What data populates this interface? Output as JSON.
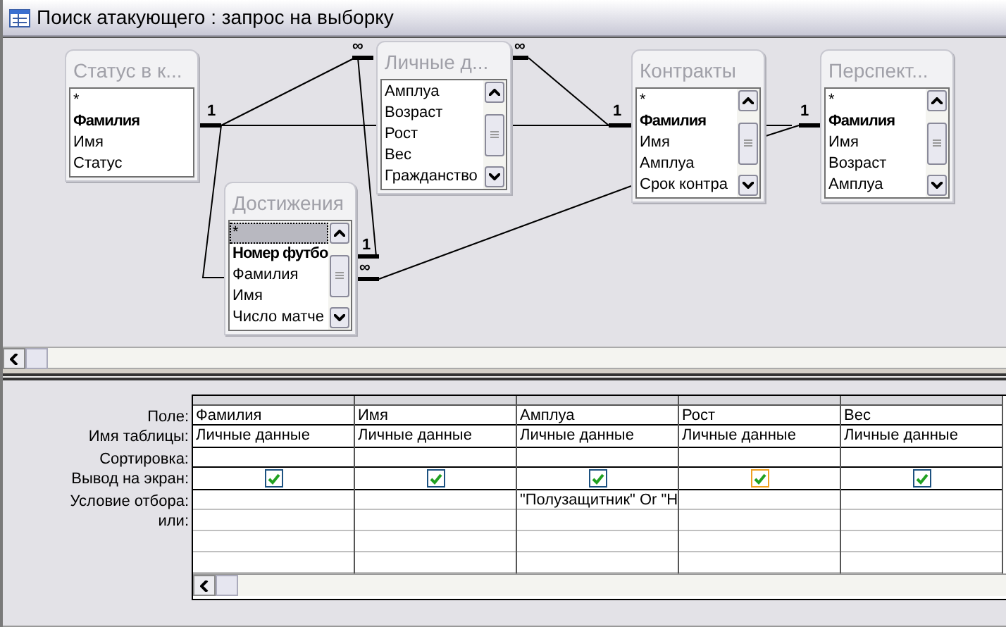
{
  "window": {
    "title": "Поиск атакующего : запрос на выборку"
  },
  "tables": [
    {
      "title": "Статус в к...",
      "scrollbar": false,
      "fields": [
        {
          "name": "*",
          "key": false,
          "selected": false
        },
        {
          "name": "Фамилия",
          "key": true,
          "selected": false
        },
        {
          "name": "Имя",
          "key": false,
          "selected": false
        },
        {
          "name": "Статус",
          "key": false,
          "selected": false
        }
      ]
    },
    {
      "title": "Личные д...",
      "scrollbar": true,
      "fields": [
        {
          "name": "Амплуа",
          "key": false,
          "selected": false
        },
        {
          "name": "Возраст",
          "key": false,
          "selected": false
        },
        {
          "name": "Рост",
          "key": false,
          "selected": false
        },
        {
          "name": "Вес",
          "key": false,
          "selected": false
        },
        {
          "name": "Гражданство",
          "key": false,
          "selected": false
        }
      ]
    },
    {
      "title": "Достижения",
      "scrollbar": true,
      "fields": [
        {
          "name": "*",
          "key": false,
          "selected": true
        },
        {
          "name": "Номер футбо",
          "key": true,
          "selected": false
        },
        {
          "name": "Фамилия",
          "key": false,
          "selected": false
        },
        {
          "name": "Имя",
          "key": false,
          "selected": false
        },
        {
          "name": "Число матче",
          "key": false,
          "selected": false
        }
      ]
    },
    {
      "title": "Контракты",
      "scrollbar": true,
      "fields": [
        {
          "name": "*",
          "key": false,
          "selected": false
        },
        {
          "name": "Фамилия",
          "key": true,
          "selected": false
        },
        {
          "name": "Имя",
          "key": false,
          "selected": false
        },
        {
          "name": "Амплуа",
          "key": false,
          "selected": false
        },
        {
          "name": "Срок контра",
          "key": false,
          "selected": false
        }
      ]
    },
    {
      "title": "Перспект...",
      "scrollbar": true,
      "fields": [
        {
          "name": "*",
          "key": false,
          "selected": false
        },
        {
          "name": "Фамилия",
          "key": true,
          "selected": false
        },
        {
          "name": "Имя",
          "key": false,
          "selected": false
        },
        {
          "name": "Возраст",
          "key": false,
          "selected": false
        },
        {
          "name": "Амплуа",
          "key": false,
          "selected": false
        }
      ]
    }
  ],
  "join_marks": [
    "1",
    "∞",
    "∞",
    "1",
    "1",
    "1",
    "∞"
  ],
  "grid": {
    "row_labels": [
      "Поле:",
      "Имя таблицы:",
      "Сортировка:",
      "Вывод на экран:",
      "Условие отбора:",
      "или:"
    ],
    "columns": [
      {
        "field": "Фамилия",
        "table": "Личные данные",
        "show": true,
        "highlighted": false
      },
      {
        "field": "Имя",
        "table": "Личные данные",
        "show": true,
        "highlighted": false
      },
      {
        "field": "Амплуа",
        "table": "Личные данные",
        "show": true,
        "highlighted": false,
        "criteria": "\"Полузащитник\" Or \"H"
      },
      {
        "field": "Рост",
        "table": "Личные данные",
        "show": true,
        "highlighted": true
      },
      {
        "field": "Вес",
        "table": "Личные данные",
        "show": true,
        "highlighted": false
      }
    ]
  }
}
